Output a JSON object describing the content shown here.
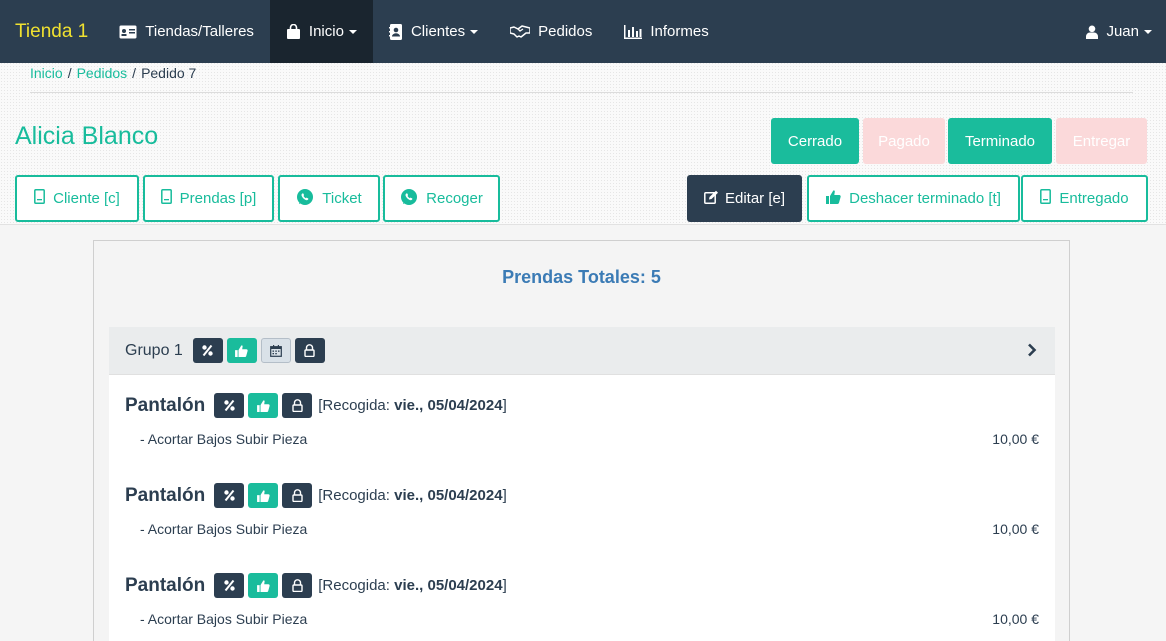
{
  "navbar": {
    "brand": "Tienda 1",
    "items": [
      {
        "label": "Tiendas/Talleres",
        "icon": "id-card-icon"
      },
      {
        "label": "Inicio",
        "icon": "shopping-bag-icon",
        "dropdown": true,
        "active": true
      },
      {
        "label": "Clientes",
        "icon": "address-book-icon",
        "dropdown": true
      },
      {
        "label": "Pedidos",
        "icon": "handshake-icon"
      },
      {
        "label": "Informes",
        "icon": "bar-chart-icon"
      }
    ],
    "user": {
      "label": "Juan",
      "icon": "user-icon"
    }
  },
  "breadcrumb": {
    "items": [
      "Inicio",
      "Pedidos"
    ],
    "current": "Pedido 7",
    "separator": "/"
  },
  "customer": {
    "name": "Alicia Blanco"
  },
  "status_buttons": [
    {
      "label": "Cerrado",
      "state": "on"
    },
    {
      "label": "Pagado",
      "state": "off"
    },
    {
      "label": "Terminado",
      "state": "on"
    },
    {
      "label": "Entregar",
      "state": "off"
    }
  ],
  "actions": {
    "cliente": "Cliente [c]",
    "prendas": "Prendas [p]",
    "ticket": "Ticket",
    "recoger": "Recoger",
    "editar": "Editar [e]",
    "deshacer": "Deshacer terminado [t]",
    "entregado": "Entregado"
  },
  "panel": {
    "heading": "Prendas Totales: 5",
    "group": {
      "label": "Grupo 1"
    },
    "items": [
      {
        "name": "Pantalón",
        "pickup_label": "[Recogida: ",
        "pickup_date": "vie., 05/04/2024",
        "pickup_close": "]",
        "service": "- Acortar Bajos Subir Pieza",
        "price": "10,00 €"
      },
      {
        "name": "Pantalón",
        "pickup_label": "[Recogida: ",
        "pickup_date": "vie., 05/04/2024",
        "pickup_close": "]",
        "service": "- Acortar Bajos Subir Pieza",
        "price": "10,00 €"
      },
      {
        "name": "Pantalón",
        "pickup_label": "[Recogida: ",
        "pickup_date": "vie., 05/04/2024",
        "pickup_close": "]",
        "service": "- Acortar Bajos Subir Pieza",
        "price": "10,00 €"
      }
    ]
  },
  "colors": {
    "navbar": "#2c3e50",
    "brand": "#f0e130",
    "accent": "#18bc9c",
    "disabled_status": "#fbd9da",
    "heading": "#3b7bb5"
  }
}
